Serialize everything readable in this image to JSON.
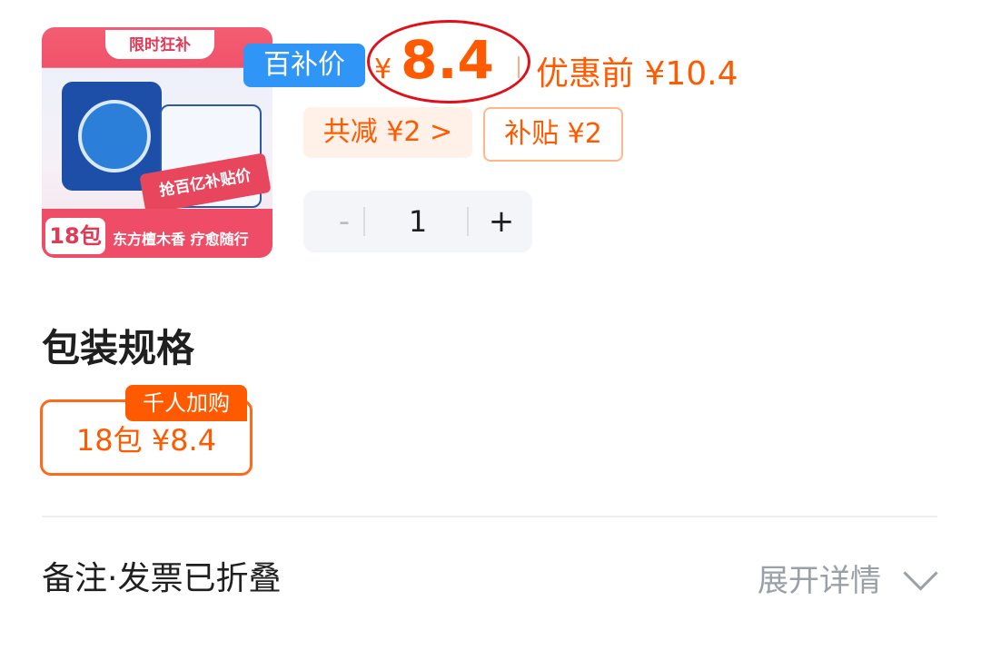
{
  "product": {
    "image_badge_top": "限时狂补",
    "image_banner": "抢百亿补贴价",
    "image_pack_count": "18包",
    "image_bottom_text": "东方檀木香 疗愈随行"
  },
  "pricing": {
    "tag": "百补价",
    "currency": "¥",
    "price": "8.4",
    "original_label": "优惠前 ¥10.4"
  },
  "discounts": [
    {
      "label": "共减 ¥2 >"
    },
    {
      "label": "补贴 ¥2"
    }
  ],
  "quantity": {
    "minus": "-",
    "value": "1",
    "plus": "+"
  },
  "spec": {
    "title": "包装规格",
    "badge": "千人加购",
    "option": "18包  ¥8.4"
  },
  "remark": {
    "label": "备注·发票已折叠",
    "expand": "展开详情"
  },
  "colors": {
    "accent": "#ff5a00",
    "blue_tag": "#2f95f6",
    "highlight_oval": "#e10f1a"
  }
}
